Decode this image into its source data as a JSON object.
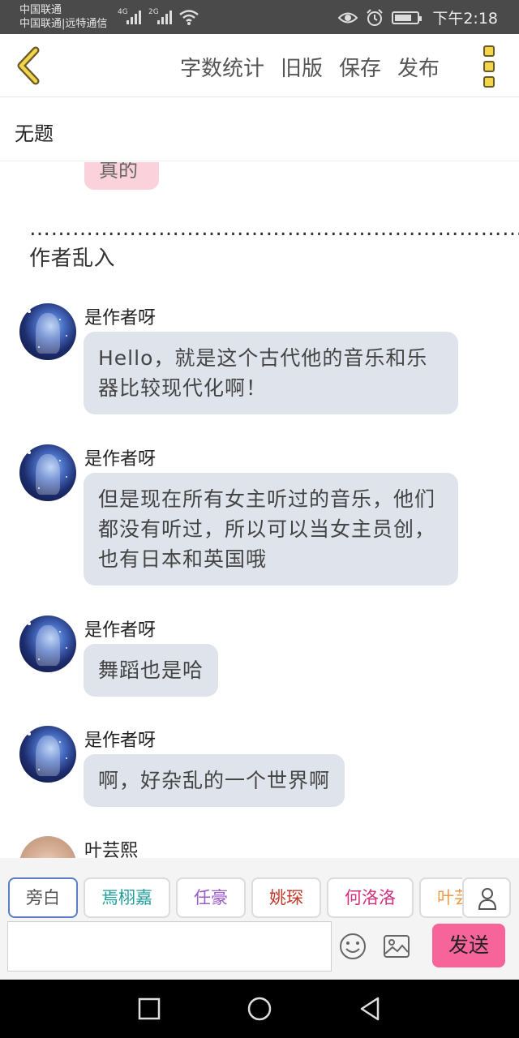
{
  "status_bar": {
    "carrier_1": "中国联通",
    "carrier_2": "中国联通|远特通信",
    "network_1": "4G",
    "network_2": "2G",
    "time": "下午2:18",
    "icons": [
      "signal-icon",
      "wifi-icon",
      "eye-icon",
      "alarm-icon",
      "battery-icon"
    ]
  },
  "toolbar": {
    "back_icon": "chevron-left-icon",
    "word_count": "字数统计",
    "old_version": "旧版",
    "save": "保存",
    "publish": "发布",
    "more_icon": "more-vertical-icon"
  },
  "title": "无题",
  "partial_bubble_text": "真的",
  "narration": "……………………………………………………………作者乱入",
  "messages": [
    {
      "speaker": "是作者呀",
      "text": "Hello，就是这个古代他的音乐和乐器比较现代化啊！"
    },
    {
      "speaker": "是作者呀",
      "text": "但是现在所有女主听过的音乐，他们都没有听过，所以可以当女主员创，也有日本和英国哦"
    },
    {
      "speaker": "是作者呀",
      "text": "舞蹈也是哈"
    },
    {
      "speaker": "是作者呀",
      "text": "啊，好杂乱的一个世界啊"
    },
    {
      "speaker": "叶芸熙",
      "text": ""
    }
  ],
  "roles": [
    {
      "label": "旁白",
      "color": "#555555"
    },
    {
      "label": "焉栩嘉",
      "color": "#1f9e9b"
    },
    {
      "label": "任豪",
      "color": "#9b59c9"
    },
    {
      "label": "姚琛",
      "color": "#c0392b"
    },
    {
      "label": "何洛洛",
      "color": "#d0307c"
    },
    {
      "label": "叶芸",
      "color": "#ef9a4a"
    }
  ],
  "composer": {
    "input_value": "",
    "emoji_icon": "emoji-icon",
    "image_icon": "image-icon",
    "user_icon": "user-icon",
    "send_label": "发送",
    "send_color": "#f7649a"
  },
  "nav": [
    "square-recent-icon",
    "circle-home-icon",
    "triangle-back-icon"
  ]
}
